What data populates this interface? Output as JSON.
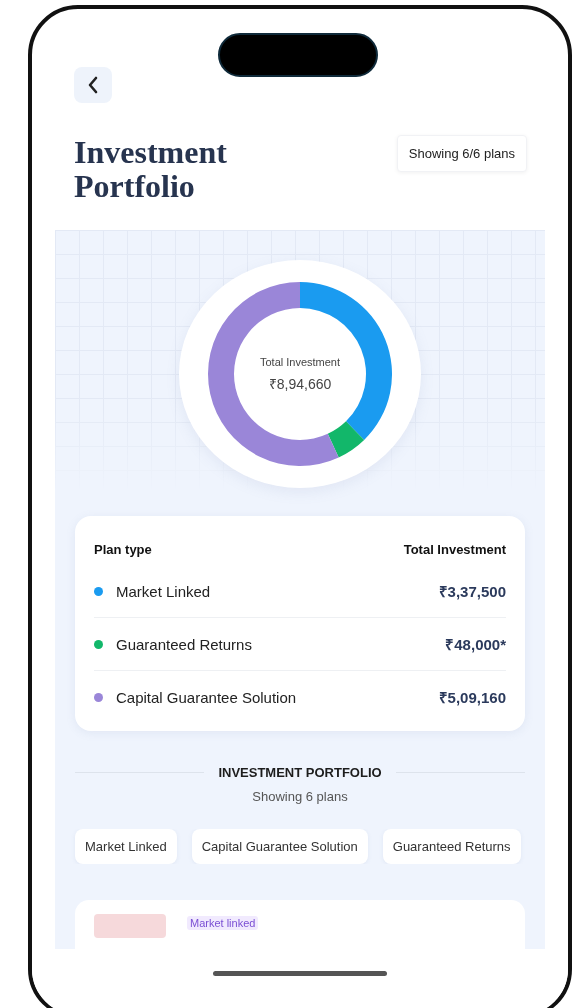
{
  "header": {
    "title": "Investment Portfolio",
    "badge": "Showing 6/6 plans"
  },
  "summary": {
    "center_label": "Total Investment",
    "center_value": "₹8,94,660"
  },
  "plan_table": {
    "columns": [
      "Plan type",
      "Total Investment"
    ],
    "rows": [
      {
        "name": "Market Linked",
        "amount": "₹3,37,500",
        "color": "#1a9bf0"
      },
      {
        "name": "Guaranteed Returns",
        "amount": "₹48,000*",
        "color": "#12b76a"
      },
      {
        "name": "Capital Guarantee Solution",
        "amount": "₹5,09,160",
        "color": "#9a86d8"
      }
    ]
  },
  "portfolio_section": {
    "heading": "INVESTMENT PORTFOLIO",
    "subheading": "Showing 6 plans",
    "filters": [
      {
        "label": "Market Linked",
        "selected": false
      },
      {
        "label": "Capital Guarantee Solution",
        "selected": false
      },
      {
        "label": "Guaranteed Returns",
        "selected": false
      }
    ]
  },
  "plan_cards": [
    {
      "tag": "Market linked"
    }
  ]
}
